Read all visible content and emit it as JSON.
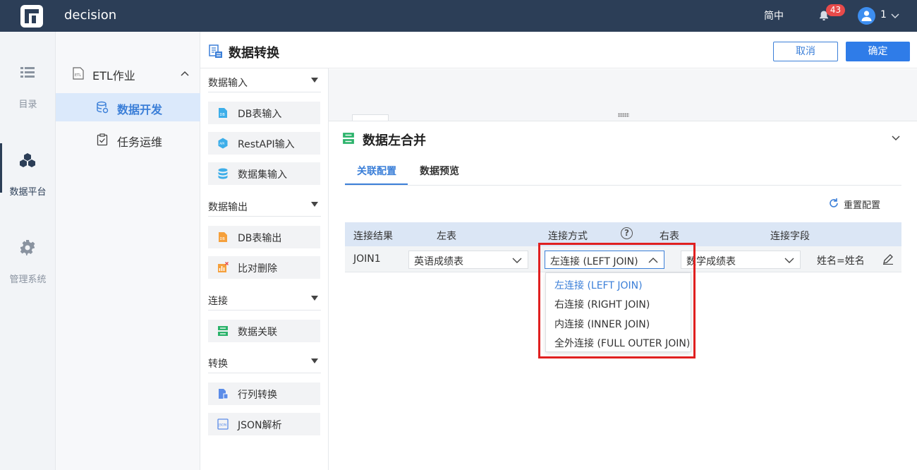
{
  "topbar": {
    "app_title": "decision",
    "language": "简中",
    "notification_count": "43",
    "user_name": "1"
  },
  "leftnav": [
    {
      "label": "目录",
      "icon": "list-icon"
    },
    {
      "label": "数据平台",
      "icon": "cube-cluster-icon",
      "active": true
    },
    {
      "label": "管理系统",
      "icon": "gear-icon"
    }
  ],
  "tree": {
    "group_label": "ETL作业",
    "items": [
      {
        "label": "数据开发",
        "selected": true
      },
      {
        "label": "任务运维",
        "selected": false
      }
    ]
  },
  "header": {
    "title": "数据转换",
    "cancel_label": "取消",
    "ok_label": "确定"
  },
  "palette": {
    "sections": [
      {
        "title": "数据输入",
        "items": [
          "DB表输入",
          "RestAPI输入",
          "数据集输入"
        ]
      },
      {
        "title": "数据输出",
        "items": [
          "DB表输出",
          "比对删除"
        ]
      },
      {
        "title": "连接",
        "items": [
          "数据关联"
        ]
      },
      {
        "title": "转换",
        "items": [
          "行列转换",
          "JSON解析"
        ]
      }
    ]
  },
  "config": {
    "title": "数据左合并",
    "tabs": [
      "关联配置",
      "数据预览"
    ],
    "reset_label": "重置配置",
    "columns": [
      "连接结果",
      "左表",
      "连接方式",
      "右表",
      "连接字段"
    ],
    "row": {
      "result": "JOIN1",
      "left_table": "英语成绩表",
      "join_type": "左连接 (LEFT JOIN)",
      "right_table": "数学成绩表",
      "join_field": "姓名=姓名"
    },
    "join_options": [
      "左连接 (LEFT JOIN)",
      "右连接 (RIGHT JOIN)",
      "内连接 (INNER JOIN)",
      "全外连接 (FULL OUTER JOIN)"
    ]
  },
  "colors": {
    "topbar": "#2c3e57",
    "accent": "#3b7fd8",
    "highlight": "#e02020"
  }
}
